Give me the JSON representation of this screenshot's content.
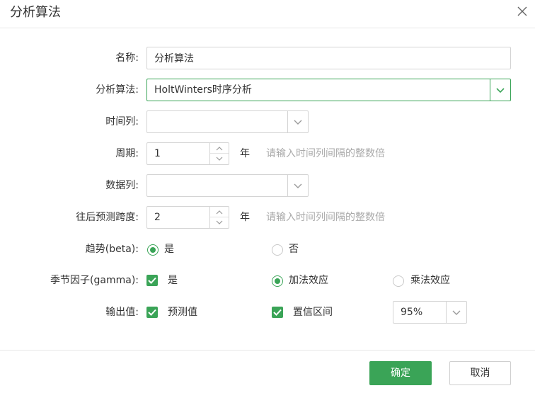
{
  "dialog": {
    "title": "分析算法",
    "close_icon": "close-icon"
  },
  "form": {
    "name": {
      "label": "名称:",
      "value": "分析算法"
    },
    "algorithm": {
      "label": "分析算法:",
      "value": "HoltWinters时序分析"
    },
    "time_column": {
      "label": "时间列:",
      "value": ""
    },
    "period": {
      "label": "周期:",
      "value": "1",
      "unit": "年",
      "hint": "请输入时间列间隔的整数倍"
    },
    "data_column": {
      "label": "数据列:",
      "value": ""
    },
    "forecast_span": {
      "label": "往后预测跨度:",
      "value": "2",
      "unit": "年",
      "hint": "请输入时间列间隔的整数倍"
    },
    "trend": {
      "label": "趋势(beta):",
      "options": [
        "是",
        "否"
      ],
      "selected": "是"
    },
    "seasonal": {
      "label": "季节因子(gamma):",
      "checkbox_label": "是",
      "checked": true,
      "options": [
        "加法效应",
        "乘法效应"
      ],
      "selected": "加法效应"
    },
    "output": {
      "label": "输出值:",
      "forecast_label": "预测值",
      "forecast_checked": true,
      "confidence_label": "置信区间",
      "confidence_checked": true,
      "confidence_level": "95%"
    }
  },
  "footer": {
    "ok_label": "确定",
    "cancel_label": "取消"
  },
  "colors": {
    "accent": "#3aa457",
    "border": "#d4d4d4",
    "hint": "#aaaaaa"
  }
}
